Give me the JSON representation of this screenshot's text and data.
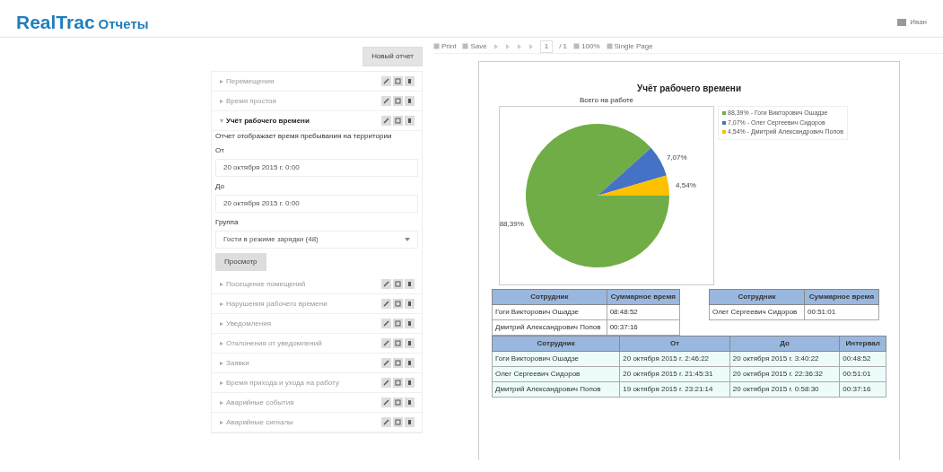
{
  "header": {
    "logo": "RealTrac",
    "title": "Отчеты",
    "user_name": "Иван"
  },
  "new_report_button": "Новый отчет",
  "reports": [
    {
      "name": "Перемещения",
      "expanded": false
    },
    {
      "name": "Время простоя",
      "expanded": false
    },
    {
      "name": "Учёт рабочего времени",
      "expanded": true,
      "description": "Отчет отображает время пребывания на территории",
      "fields": [
        {
          "kind": "date",
          "label": "От",
          "value": "20 октября 2015 г. 0:00"
        },
        {
          "kind": "date",
          "label": "До",
          "value": "20 октября 2015 г. 0:00"
        },
        {
          "kind": "select",
          "label": "Группа",
          "value": "Гости в режиме зарядки (48)"
        }
      ],
      "submit": "Просмотр"
    },
    {
      "name": "Посещение помещений",
      "expanded": false
    },
    {
      "name": "Нарушения рабочего времени",
      "expanded": false
    },
    {
      "name": "Уведомления",
      "expanded": false
    },
    {
      "name": "Отклонения от уведомлений",
      "expanded": false
    },
    {
      "name": "Заявки",
      "expanded": false
    },
    {
      "name": "Время прихода и ухода на работу",
      "expanded": false
    },
    {
      "name": "Аварийные события",
      "expanded": false
    },
    {
      "name": "Аварийные сигналы",
      "expanded": false
    }
  ],
  "toolbar": {
    "print": "Print",
    "save": "Save",
    "page": "1",
    "page_total": "/ 1",
    "zoom": "100%",
    "view": "Single Page"
  },
  "report": {
    "title": "Учёт рабочего времени",
    "chart_data": {
      "type": "pie",
      "categories": [
        "88,39% - Гоги Викторович Ошадзе",
        "7,07% - Олег Сергеевич Сидоров",
        "4,54% - Дмитрий Александрович Попов"
      ],
      "series": [
        {
          "name": "Всего на работе",
          "values": [
            88.39,
            7.07,
            4.54
          ]
        }
      ],
      "data_labels": "value_labels",
      "legend": "right",
      "value_labels": [
        "88,39%",
        "7,07%",
        "4,54%"
      ]
    },
    "tables": [
      {
        "columns": [
          "Сотрудник",
          "Суммарное время"
        ],
        "rows": [
          [
            "Гоги Викторович Ошадзе",
            "08:48:52"
          ],
          [
            "Дмитрий Александрович Попов",
            "00:37:16"
          ]
        ]
      },
      {
        "columns": [
          "Сотрудник",
          "Суммарное время"
        ],
        "rows": [
          [
            "Олег Сергеевич Сидоров",
            "00:51:01"
          ]
        ]
      },
      {
        "columns": [
          "Сотрудник",
          "От",
          "До",
          "Интервал"
        ],
        "rows": [
          [
            "Гоги Викторович Ошадзе",
            "20 октября 2015 г. 2:46:22",
            "20 октября 2015 г. 3:40:22",
            "00:48:52"
          ],
          [
            "Олег Сергеевич Сидоров",
            "20 октября 2015 г. 21:45:31",
            "20 октября 2015 г. 22:36:32",
            "00:51:01"
          ],
          [
            "Дмитрий Александрович Попов",
            "19 октября 2015 г. 23:21:14",
            "20 октября 2015 г. 0:58:30",
            "00:37:16"
          ]
        ]
      }
    ]
  }
}
